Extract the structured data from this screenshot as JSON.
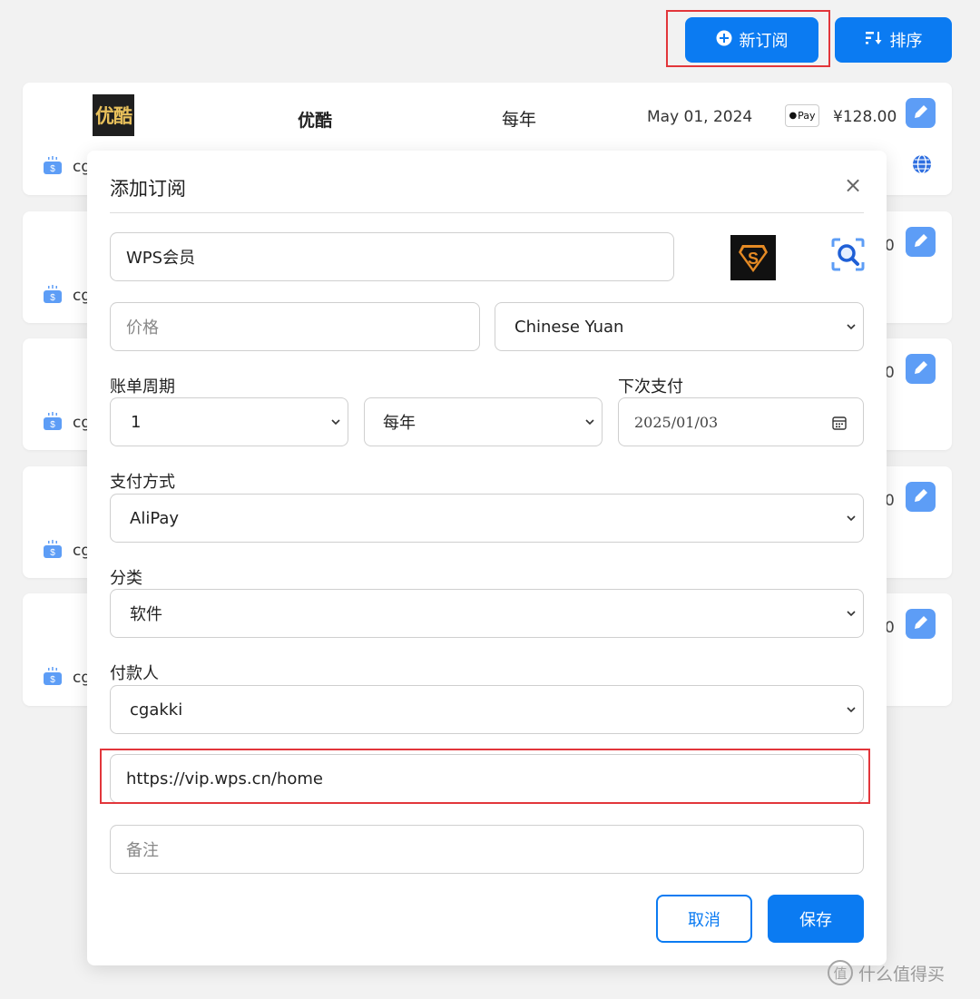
{
  "toolbar": {
    "new_label": "新订阅",
    "sort_label": "排序"
  },
  "cards": [
    {
      "name": "优酷",
      "logo_text": "优酷",
      "cycle": "每年",
      "date": "May 01, 2024",
      "payment_badge": "Pay",
      "price": "¥128.00",
      "owner": "cg"
    },
    {
      "owner": "cg",
      "price_suffix": "0"
    },
    {
      "owner": "cg",
      "price_suffix": "0"
    },
    {
      "owner": "cg",
      "price_suffix": "0"
    },
    {
      "owner": "cg",
      "price_suffix": "0"
    }
  ],
  "modal": {
    "title": "添加订阅",
    "close": "×",
    "name_value": "WPS会员",
    "logo_glyph": "S",
    "price_placeholder": "价格",
    "currency": "Chinese Yuan",
    "billing_label": "账单周期",
    "billing_count": "1",
    "billing_unit": "每年",
    "next_pay_label": "下次支付",
    "next_pay_date": "2025/01/03",
    "payment_label": "支付方式",
    "payment_value": "AliPay",
    "category_label": "分类",
    "category_value": "软件",
    "payer_label": "付款人",
    "payer_value": "cgakki",
    "url_value": "https://vip.wps.cn/home",
    "notes_placeholder": "备注",
    "cancel_label": "取消",
    "save_label": "保存"
  },
  "watermark": {
    "glyph": "值",
    "text": "什么值得买"
  },
  "colors": {
    "primary": "#0b7bf2",
    "edit_button": "#5d9df6",
    "highlight": "#e2363b",
    "background": "#f2f2f2"
  }
}
